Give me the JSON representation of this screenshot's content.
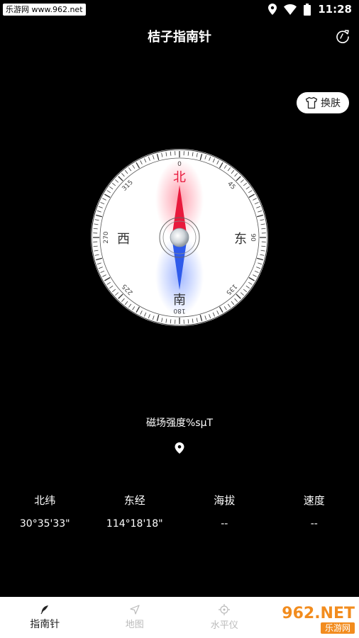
{
  "status_bar": {
    "watermark": "乐游网 www.962.net",
    "time": "11:28"
  },
  "header": {
    "title": "桔子指南针"
  },
  "skin_button": {
    "label": "换肤"
  },
  "compass": {
    "heading_deg": 0,
    "directions": {
      "north": "北",
      "south": "南",
      "east": "东",
      "west": "西"
    },
    "degree_labels": [
      "0",
      "45",
      "90",
      "135",
      "180",
      "225",
      "270",
      "315"
    ],
    "colors": {
      "north": "#e8193c",
      "south": "#2f5bea"
    }
  },
  "magnetic": {
    "label": "磁场强度%sμT"
  },
  "info": [
    {
      "label": "北纬",
      "value": "30°35'33\""
    },
    {
      "label": "东经",
      "value": "114°18'18\""
    },
    {
      "label": "海拔",
      "value": "--"
    },
    {
      "label": "速度",
      "value": "--"
    }
  ],
  "tabs": [
    {
      "label": "指南针",
      "icon": "feather-icon",
      "active": true
    },
    {
      "label": "地图",
      "icon": "navigation-arrow-icon",
      "active": false
    },
    {
      "label": "水平仪",
      "icon": "crosshair-icon",
      "active": false
    }
  ],
  "brand_watermark": {
    "top": "962.NET",
    "bottom": "乐游网"
  }
}
